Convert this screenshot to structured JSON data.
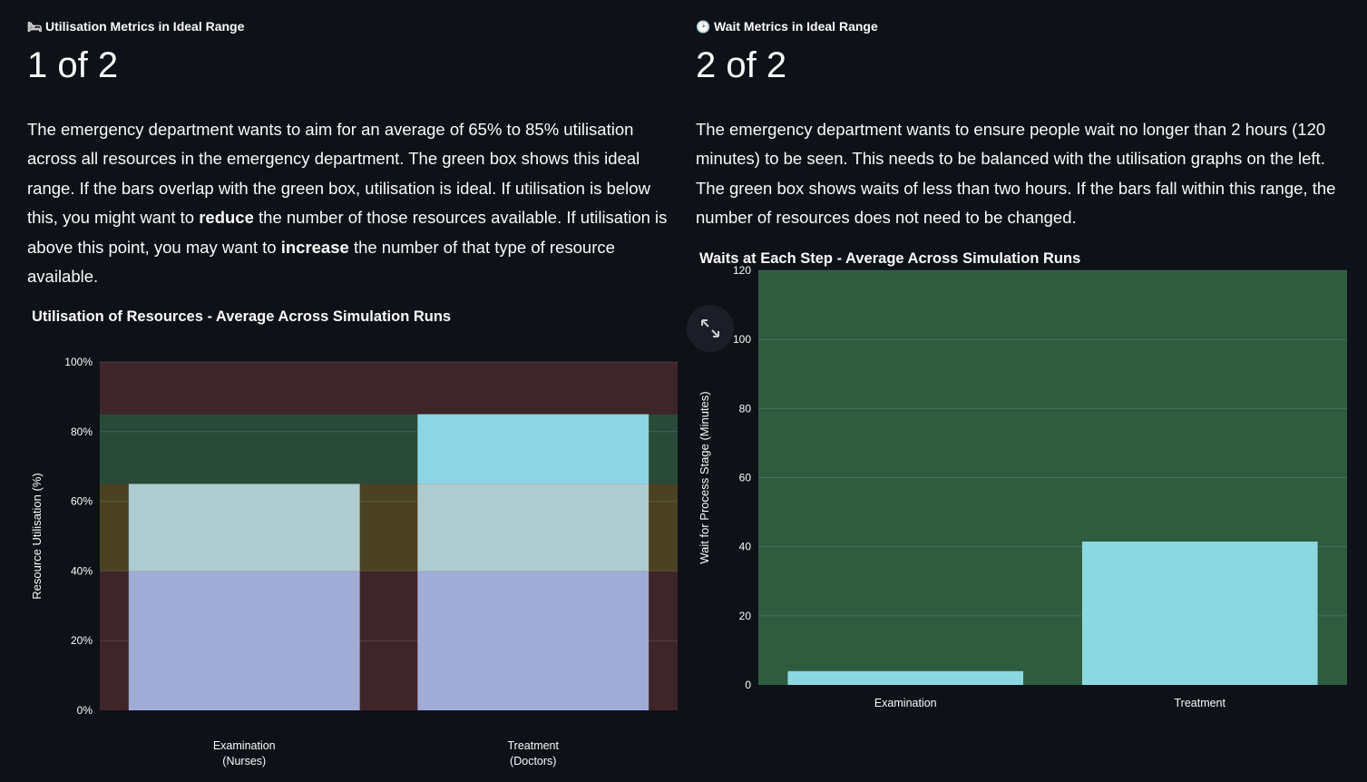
{
  "left": {
    "metric_icon": "bed-icon",
    "metric_icon_glyph": "🛏",
    "metric_label": "Utilisation Metrics in Ideal Range",
    "metric_value": "1 of 2",
    "desc_p1": "The emergency department wants to aim for an average of 65% to 85% utilisation across all resources in the emergency department. The green box shows this ideal range. If the bars overlap with the green box, utilisation is ideal. If utilisation is below this, you might want to ",
    "desc_b1": "reduce",
    "desc_p2": " the number of those resources available. If utilisation is above this point, you may want to ",
    "desc_b2": "increase",
    "desc_p3": " the number of that type of resource available."
  },
  "right": {
    "metric_icon": "clock-icon",
    "metric_icon_glyph": "🕑",
    "metric_label": "Wait Metrics in Ideal Range",
    "metric_value": "2 of 2",
    "desc": "The emergency department wants to ensure people wait no longer than 2 hours (120 minutes) to be seen. This needs to be balanced with the utilisation graphs on the left. The green box shows waits of less than two hours. If the bars fall within this range, the number of resources does not need to be changed."
  },
  "expand_icon": "expand-icon",
  "chart_data": [
    {
      "type": "bar",
      "title": "Utilisation of Resources - Average Across Simulation Runs",
      "xlabel": "",
      "ylabel": "Resource Utilisation (%)",
      "categories": [
        "Examination\n(Nurses)",
        "Treatment\n(Doctors)"
      ],
      "values": [
        65,
        85
      ],
      "ylim": [
        0,
        100
      ],
      "yticks": [
        0,
        20,
        40,
        60,
        80,
        100
      ],
      "ytick_suffix": "%",
      "bar_color": "#a9d9e3",
      "bands": [
        {
          "from": 0,
          "to": 40,
          "color": "#3e2529"
        },
        {
          "from": 40,
          "to": 65,
          "color": "#4a4222"
        },
        {
          "from": 65,
          "to": 85,
          "color": "#284b39"
        },
        {
          "from": 85,
          "to": 100,
          "color": "#3e2529"
        }
      ],
      "bar_segment_colors": [
        {
          "from": 0,
          "to": 40,
          "color": "#a0acd6"
        },
        {
          "from": 40,
          "to": 65,
          "color": "#aecbcf"
        },
        {
          "from": 65,
          "to": 85,
          "color": "#8cd5e5"
        }
      ],
      "grid": true
    },
    {
      "type": "bar",
      "title": "Waits at Each Step - Average Across Simulation Runs",
      "xlabel": "",
      "ylabel": "Wait for Process Stage (Minutes)",
      "categories": [
        "Examination",
        "Treatment"
      ],
      "values": [
        4,
        41.5
      ],
      "ylim": [
        0,
        120
      ],
      "yticks": [
        0,
        20,
        40,
        60,
        80,
        100,
        120
      ],
      "ytick_suffix": "",
      "bar_color": "#8bd8e0",
      "bands": [
        {
          "from": 0,
          "to": 120,
          "color": "#2f5b3f"
        }
      ],
      "grid": true
    }
  ]
}
